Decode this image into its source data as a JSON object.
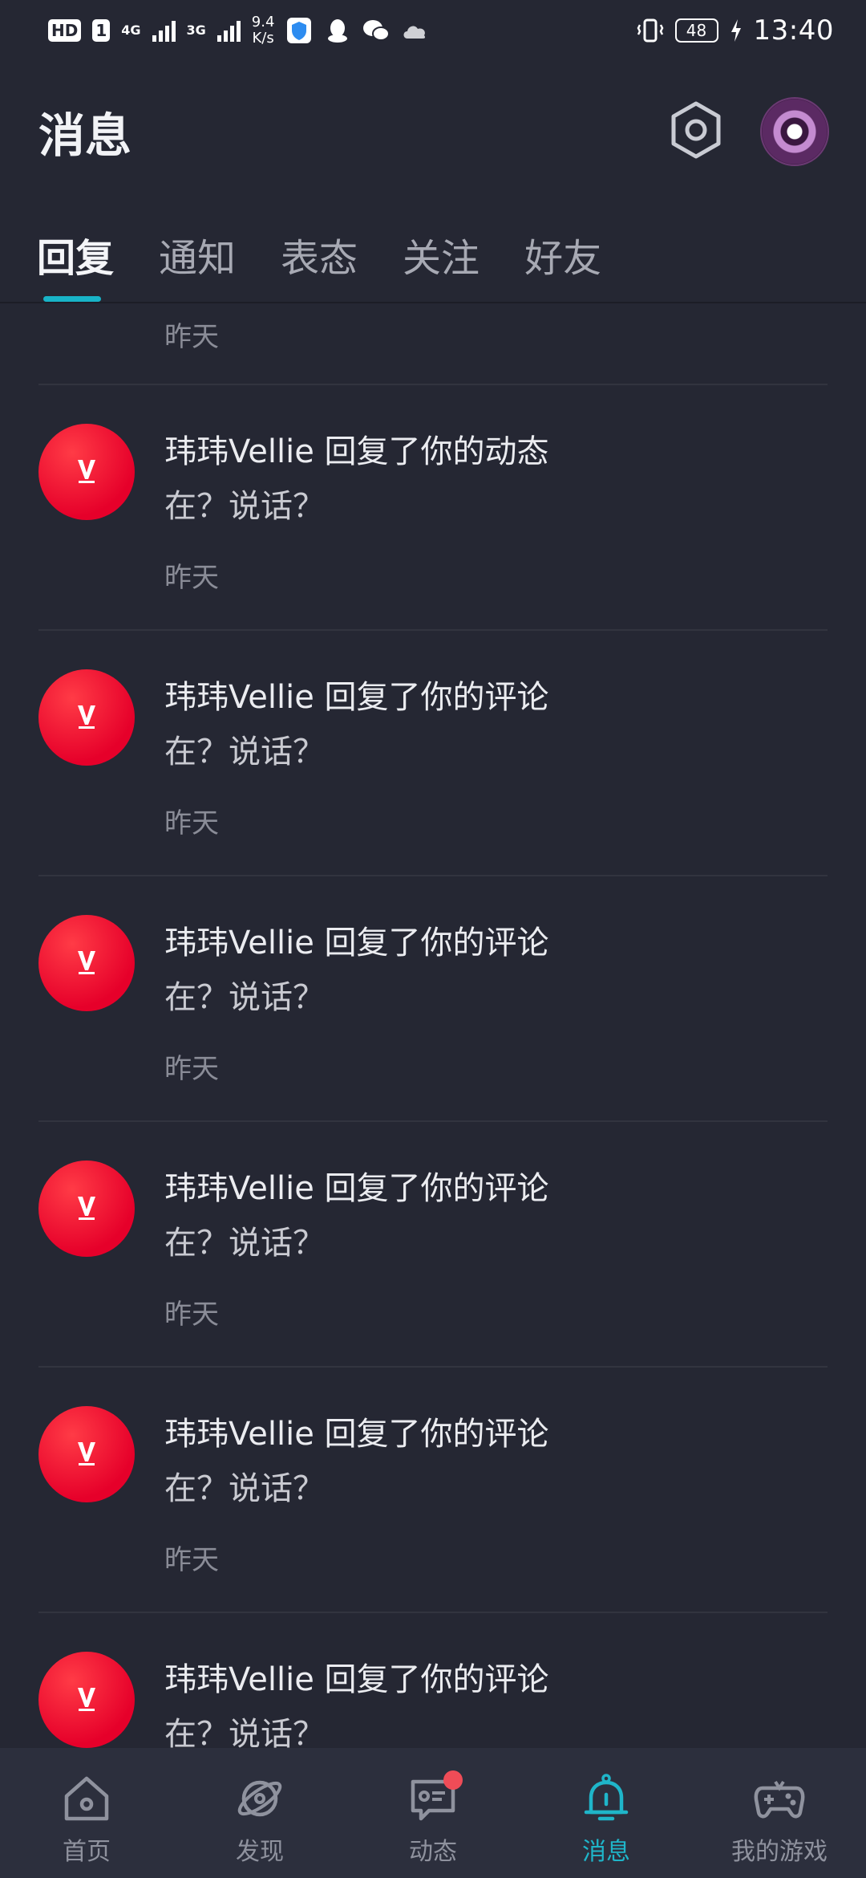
{
  "status_bar": {
    "hd": "HD",
    "sim": "1",
    "net1": "4G",
    "net2": "3G",
    "speed": "9.4",
    "speed_unit": "K/s",
    "battery": "48",
    "time": "13:40"
  },
  "header": {
    "title": "消息"
  },
  "tabs": [
    {
      "label": "回复",
      "active": true
    },
    {
      "label": "通知",
      "active": false
    },
    {
      "label": "表态",
      "active": false
    },
    {
      "label": "关注",
      "active": false
    },
    {
      "label": "好友",
      "active": false
    }
  ],
  "list": {
    "partial_top_time": "昨天",
    "items": [
      {
        "title": "玮玮Vellie 回复了你的动态",
        "content": "在？说话？",
        "time": "昨天"
      },
      {
        "title": "玮玮Vellie 回复了你的评论",
        "content": "在？说话？",
        "time": "昨天"
      },
      {
        "title": "玮玮Vellie 回复了你的评论",
        "content": "在？说话？",
        "time": "昨天"
      },
      {
        "title": "玮玮Vellie 回复了你的评论",
        "content": "在？说话？",
        "time": "昨天"
      },
      {
        "title": "玮玮Vellie 回复了你的评论",
        "content": "在？说话？",
        "time": "昨天"
      },
      {
        "title": "玮玮Vellie 回复了你的评论",
        "content": "在？说话？",
        "time": ""
      }
    ]
  },
  "bottom_nav": [
    {
      "label": "首页",
      "icon": "home-icon",
      "active": false
    },
    {
      "label": "发现",
      "icon": "planet-icon",
      "active": false
    },
    {
      "label": "动态",
      "icon": "feed-icon",
      "active": false,
      "dot": true
    },
    {
      "label": "消息",
      "icon": "bell-icon",
      "active": true
    },
    {
      "label": "我的游戏",
      "icon": "gamepad-icon",
      "active": false
    }
  ],
  "colors": {
    "background": "#252733",
    "accent": "#1fb5c9",
    "avatar_red": "#e6002a",
    "nav_background": "#2c2f3d"
  }
}
